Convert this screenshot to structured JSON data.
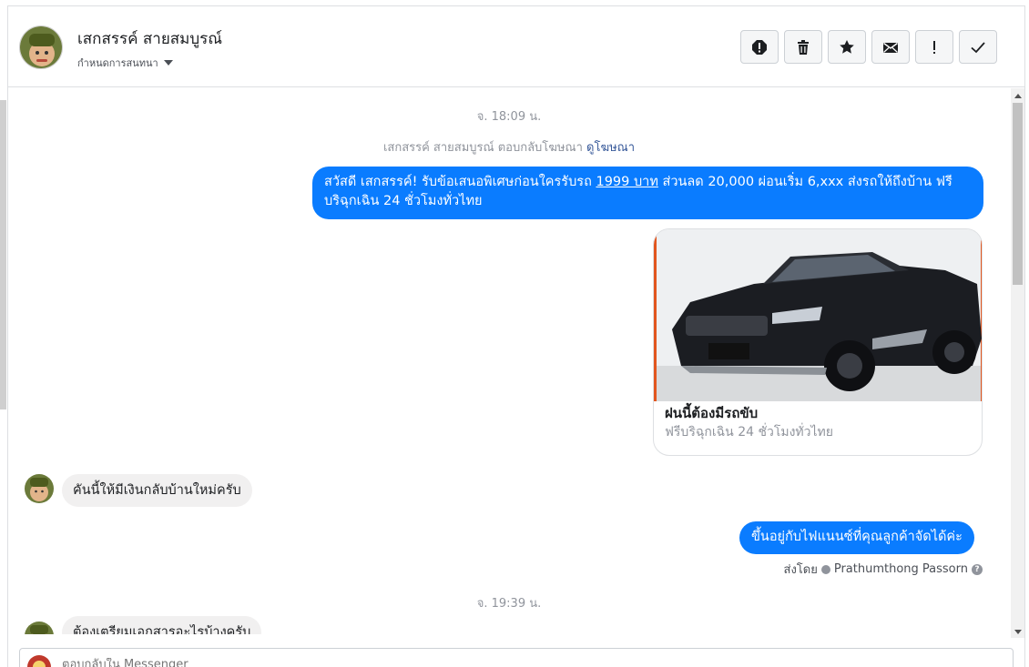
{
  "header": {
    "contact_name": "เสกสรรค์ สายสมบูรณ์",
    "assign_label": "กำหนดการสนทนา",
    "actions": [
      {
        "name": "report-spam-icon"
      },
      {
        "name": "trash-icon"
      },
      {
        "name": "star-icon"
      },
      {
        "name": "envelope-icon"
      },
      {
        "name": "exclamation-icon"
      },
      {
        "name": "checkmark-icon"
      }
    ]
  },
  "thread": {
    "timestamp_1": "จ. 18:09 น.",
    "ad_reply_text": "เสกสรรค์ สายสมบูรณ์ ตอบกลับโฆษณา",
    "ad_reply_link": "ดูโฆษณา",
    "msg_out_1_part1": "สวัสดี เสกสรรค์! รับข้อเสนอพิเศษก่อนใครรับรถ ",
    "msg_out_1_link": "1999 บาท",
    "msg_out_1_part2": " ส่วนลด 20,000  ผ่อนเริ่ม 6,xxx ส่งรถให้ถึงบ้าน ฟรี",
    "msg_out_1_line2": "บริฉุกเฉิน 24 ชั่วโมงทั่วไทย",
    "card_title": "ฝนนี้ต้องมีรถขับ",
    "card_subtitle": "ฟรีบริฉุกเฉิน 24 ชั่วโมงทั่วไทย",
    "msg_in_1": "คันนี้ให้มีเงินกลับบ้านใหม่ครับ",
    "msg_out_2": "ขึ้นอยู่กับไฟแนนซ์ที่คุณลูกค้าจัดได้ค่ะ",
    "sent_by_label": "ส่งโดย",
    "sent_by_name": "Prathumthong Passorn",
    "timestamp_2": "จ. 19:39 น.",
    "msg_in_2": "ต้องเตรียมเอกสารอะไรบ้างครับ"
  },
  "composer": {
    "placeholder": "ตอบกลับใน Messenger"
  },
  "colors": {
    "outgoing_bubble": "#0a7cff",
    "incoming_bubble": "#f1f0f0",
    "link": "#365899",
    "muted_text": "#90949c"
  }
}
